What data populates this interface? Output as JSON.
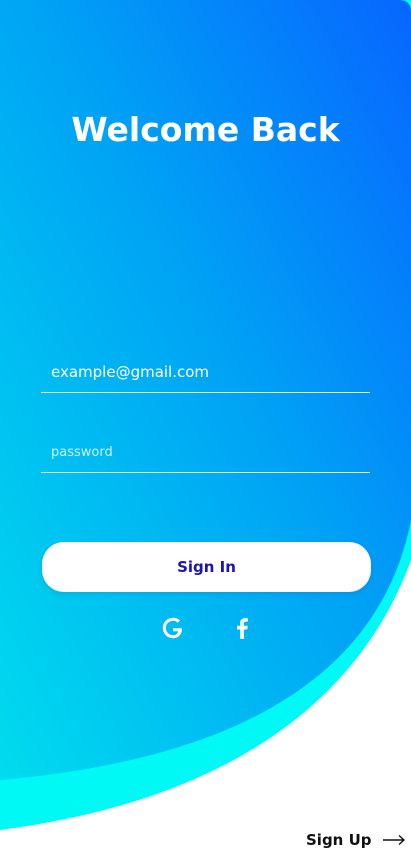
{
  "title": "Welcome Back",
  "form": {
    "email_value": "example@gmail.com",
    "password_placeholder": "password",
    "signin_label": "Sign In"
  },
  "social": {
    "google_icon": "google-icon",
    "facebook_icon": "facebook-icon"
  },
  "footer": {
    "signup_label": "Sign Up",
    "arrow_icon": "arrow-right-icon"
  },
  "colors": {
    "gradient_top": "#0a6cff",
    "gradient_bottom": "#00d9f0",
    "accent_wave": "#00f5f5",
    "signin_text": "#1a13b8"
  }
}
